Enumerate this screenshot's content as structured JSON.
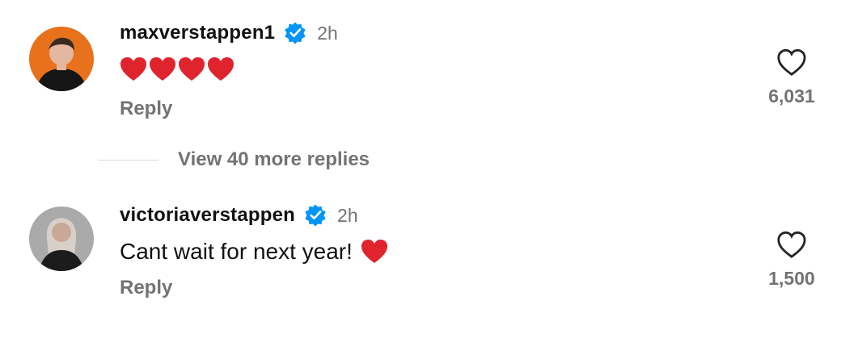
{
  "comments": [
    {
      "username": "maxverstappen1",
      "verified_icon": "verified-badge-icon",
      "time": "2h",
      "text": "",
      "emoji": [
        "heart",
        "heart",
        "heart",
        "heart"
      ],
      "reply_label": "Reply",
      "like_count": "6,031",
      "avatar_bg": "#e8711c"
    },
    {
      "username": "victoriaverstappen",
      "verified_icon": "verified-badge-icon",
      "time": "2h",
      "text": "Cant wait for next year!",
      "emoji": [
        "heart"
      ],
      "reply_label": "Reply",
      "like_count": "1,500",
      "avatar_bg": "#9a9a9a"
    }
  ],
  "view_more": "View 40 more replies",
  "colors": {
    "verified": "#0095f6",
    "heart": "#e0242e",
    "secondary_text": "#737373",
    "primary_text": "#111111"
  }
}
